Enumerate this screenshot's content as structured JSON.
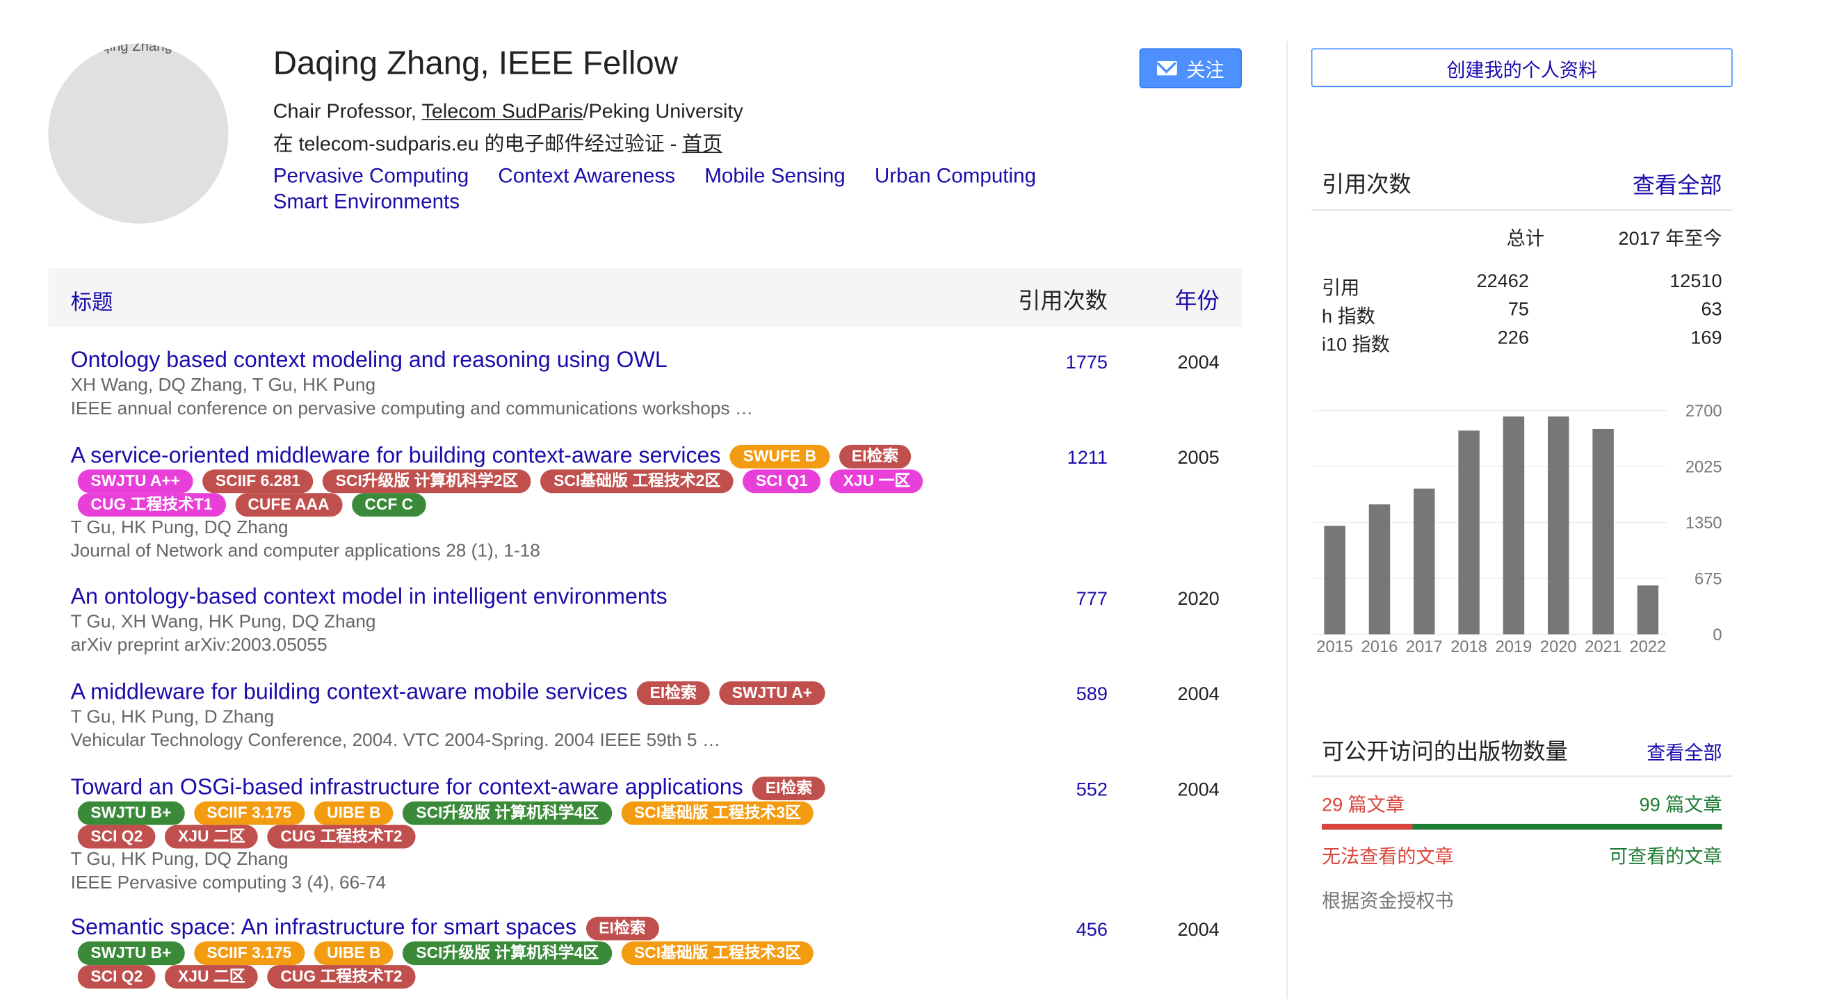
{
  "profile": {
    "avatar_alt": "Daqing Zhang",
    "name": "Daqing Zhang, IEEE Fellow",
    "affiliation_prefix": "Chair Professor, ",
    "affiliation_link": "Telecom SudParis",
    "affiliation_suffix": "/Peking University",
    "verified_text": "在 telecom-sudparis.eu 的电子邮件经过验证 - ",
    "homepage_link": "首页",
    "interests": [
      "Pervasive Computing",
      "Context Awareness",
      "Mobile Sensing",
      "Urban Computing",
      "Smart Environments"
    ],
    "follow_label": "关注"
  },
  "table": {
    "col_title": "标题",
    "col_cited": "引用次数",
    "col_year": "年份"
  },
  "articles": [
    {
      "title": "Ontology based context modeling and reasoning using OWL",
      "authors": "XH Wang, DQ Zhang, T Gu, HK Pung",
      "venue": "IEEE annual conference on pervasive computing and communications workshops …",
      "cited": "1775",
      "year": "2004",
      "inline_tags": [],
      "tag_lines": []
    },
    {
      "title": "A service-oriented middleware for building context-aware services",
      "authors": "T Gu, HK Pung, DQ Zhang",
      "venue": "Journal of Network and computer applications 28 (1), 1-18",
      "cited": "1211",
      "year": "2005",
      "inline_tags": [
        {
          "label": "SWUFE B",
          "color": "orange"
        },
        {
          "label": "EI检索",
          "color": "red"
        }
      ],
      "tag_lines": [
        [
          {
            "label": "SWJTU A++",
            "color": "pink"
          },
          {
            "label": "SCIIF 6.281",
            "color": "red"
          },
          {
            "label": "SCI升级版 计算机科学2区",
            "color": "red"
          },
          {
            "label": "SCI基础版 工程技术2区",
            "color": "red"
          },
          {
            "label": "SCI Q1",
            "color": "pink"
          },
          {
            "label": "XJU 一区",
            "color": "pink"
          }
        ],
        [
          {
            "label": "CUG 工程技术T1",
            "color": "pink"
          },
          {
            "label": "CUFE AAA",
            "color": "red"
          },
          {
            "label": "CCF C",
            "color": "green"
          }
        ]
      ]
    },
    {
      "title": "An ontology-based context model in intelligent environments",
      "authors": "T Gu, XH Wang, HK Pung, DQ Zhang",
      "venue": "arXiv preprint arXiv:2003.05055",
      "cited": "777",
      "year": "2020",
      "inline_tags": [],
      "tag_lines": []
    },
    {
      "title": "A middleware for building context-aware mobile services",
      "authors": "T Gu, HK Pung, D Zhang",
      "venue": "Vehicular Technology Conference, 2004. VTC 2004-Spring. 2004 IEEE 59th 5 …",
      "cited": "589",
      "year": "2004",
      "inline_tags": [
        {
          "label": "EI检索",
          "color": "red"
        },
        {
          "label": "SWJTU A+",
          "color": "red"
        }
      ],
      "tag_lines": []
    },
    {
      "title": "Toward an OSGi-based infrastructure for context-aware applications",
      "authors": "T Gu, HK Pung, DQ Zhang",
      "venue": "IEEE Pervasive computing 3 (4), 66-74",
      "cited": "552",
      "year": "2004",
      "inline_tags": [
        {
          "label": "EI检索",
          "color": "red"
        }
      ],
      "tag_lines": [
        [
          {
            "label": "SWJTU B+",
            "color": "green"
          },
          {
            "label": "SCIIF 3.175",
            "color": "orange"
          },
          {
            "label": "UIBE B",
            "color": "orange"
          },
          {
            "label": "SCI升级版 计算机科学4区",
            "color": "green"
          },
          {
            "label": "SCI基础版 工程技术3区",
            "color": "orange"
          }
        ],
        [
          {
            "label": "SCI Q2",
            "color": "red"
          },
          {
            "label": "XJU 二区",
            "color": "red"
          },
          {
            "label": "CUG 工程技术T2",
            "color": "red"
          }
        ]
      ]
    },
    {
      "title": "Semantic space: An infrastructure for smart spaces",
      "authors": "",
      "venue": "",
      "cited": "456",
      "year": "2004",
      "inline_tags": [
        {
          "label": "EI检索",
          "color": "red"
        }
      ],
      "tag_lines": [
        [
          {
            "label": "SWJTU B+",
            "color": "green"
          },
          {
            "label": "SCIIF 3.175",
            "color": "orange"
          },
          {
            "label": "UIBE B",
            "color": "orange"
          },
          {
            "label": "SCI升级版 计算机科学4区",
            "color": "green"
          },
          {
            "label": "SCI基础版 工程技术3区",
            "color": "orange"
          }
        ],
        [
          {
            "label": "SCI Q2",
            "color": "red"
          },
          {
            "label": "XJU 二区",
            "color": "red"
          },
          {
            "label": "CUG 工程技术T2",
            "color": "red"
          }
        ]
      ]
    }
  ],
  "sidebar": {
    "create_profile_label": "创建我的个人资料",
    "citations_title": "引用次数",
    "view_all": "查看全部",
    "col_total": "总计",
    "col_since": "2017 年至今",
    "stats": [
      {
        "label": "引用",
        "total": "22462",
        "since": "12510"
      },
      {
        "label": "h 指数",
        "total": "75",
        "since": "63"
      },
      {
        "label": "i10 指数",
        "total": "226",
        "since": "169"
      }
    ],
    "open_access_title": "可公开访问的出版物数量",
    "open_access_view_all": "查看全部",
    "oa_unavailable_count": "29 篇文章",
    "oa_available_count": "99 篇文章",
    "oa_unavailable_fraction": 0.227,
    "oa_unavailable_label": "无法查看的文章",
    "oa_available_label": "可查看的文章",
    "oa_note": "根据资金授权书"
  },
  "colors": {
    "link": "#1a0dab",
    "orange": "#f39c12",
    "red": "#c0504d",
    "pink": "#e83fd8",
    "green": "#3a8a3a",
    "bar": "#777777",
    "oa_red": "#d9453c",
    "oa_green": "#1e7b34"
  },
  "chart_data": {
    "type": "bar",
    "categories": [
      "2015",
      "2016",
      "2017",
      "2018",
      "2019",
      "2020",
      "2021",
      "2022"
    ],
    "values": [
      1310,
      1570,
      1760,
      2460,
      2630,
      2630,
      2480,
      590
    ],
    "yticks": [
      "0",
      "675",
      "1350",
      "2025",
      "2700"
    ],
    "ylim": [
      0,
      2700
    ]
  }
}
